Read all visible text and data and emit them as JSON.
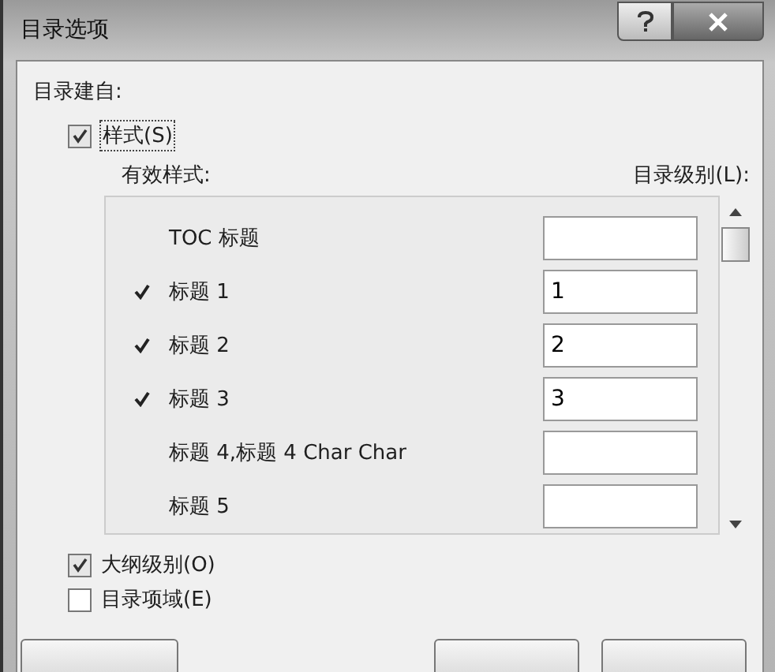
{
  "window": {
    "title": "目录选项"
  },
  "build_from_label": "目录建自:",
  "styles_option": {
    "label": "样式(S)",
    "checked": true
  },
  "columns": {
    "style": "有效样式:",
    "toc_level": "目录级别(L):"
  },
  "styles": [
    {
      "name": "TOC 标题",
      "checked": false
    },
    {
      "name": "标题 1",
      "checked": true,
      "toc_level": "1"
    },
    {
      "name": "标题 2",
      "checked": true,
      "toc_level": "2"
    },
    {
      "name": "标题 3",
      "checked": true,
      "toc_level": "3"
    },
    {
      "name": "标题 4,标题 4 Char Char",
      "checked": false
    },
    {
      "name": "标题 5",
      "checked": false
    }
  ],
  "options": [
    {
      "label": "大纲级别(O)",
      "checked": true
    },
    {
      "label": "目录项域(E)",
      "checked": false
    }
  ]
}
